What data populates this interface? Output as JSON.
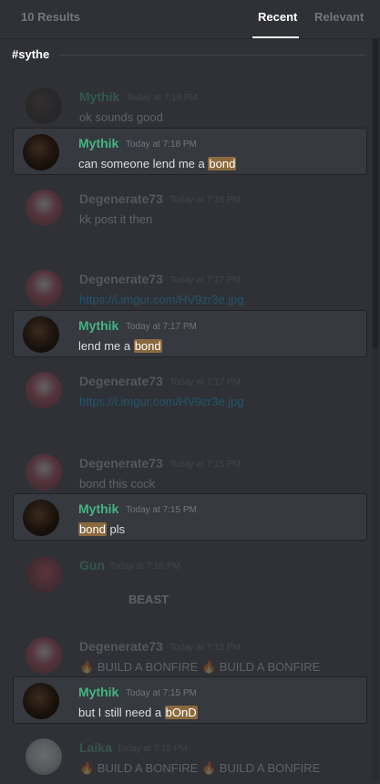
{
  "header": {
    "results_count": "10 Results",
    "tabs": [
      {
        "label": "Recent",
        "active": true
      },
      {
        "label": "Relevant",
        "active": false
      }
    ]
  },
  "channel": "#sythe",
  "messages": [
    {
      "type": "context",
      "author": "Mythik",
      "time": "Today at 7:18 PM",
      "text": "ok sounds good"
    },
    {
      "type": "hit",
      "author": "Mythik",
      "time": "Today at 7:18 PM",
      "text_before": "can someone lend me a ",
      "highlight": "bond",
      "text_after": ""
    },
    {
      "type": "context",
      "author": "Degenerate73",
      "time": "Today at 7:18 PM",
      "text": "kk post it then"
    },
    {
      "type": "context",
      "author": "Degenerate73",
      "time": "Today at 7:17 PM",
      "text": "https://i.imgur.com/HV9zr3e.jpg"
    },
    {
      "type": "hit",
      "author": "Mythik",
      "time": "Today at 7:17 PM",
      "text_before": "lend me a ",
      "highlight": "bond",
      "text_after": ""
    },
    {
      "type": "context",
      "author": "Degenerate73",
      "time": "Today at 7:17 PM",
      "text": "https://i.imgur.com/HV9zr3e.jpg"
    },
    {
      "type": "context",
      "author": "Degenerate73",
      "time": "Today at 7:15 PM",
      "text": "bond this cock"
    },
    {
      "type": "hit",
      "author": "Mythik",
      "time": "Today at 7:15 PM",
      "text_before": "",
      "highlight": "bond",
      "text_after": " pls"
    },
    {
      "type": "context",
      "author": "Gun",
      "time": "Today at 7:16 PM",
      "text": "BEAST"
    },
    {
      "type": "context",
      "author": "Degenerate73",
      "time": "Today at 7:15 PM",
      "text": "🔥 BUILD A BONFIRE 🔥 BUILD A BONFIRE"
    },
    {
      "type": "hit",
      "author": "Mythik",
      "time": "Today at 7:15 PM",
      "text_before": "but I still need a ",
      "highlight": "bOnD",
      "text_after": ""
    },
    {
      "type": "context",
      "author": "Laika",
      "time": "Today at 7:15 PM",
      "text": "🔥 BUILD A BONFIRE 🔥 BUILD A BONFIRE"
    }
  ]
}
